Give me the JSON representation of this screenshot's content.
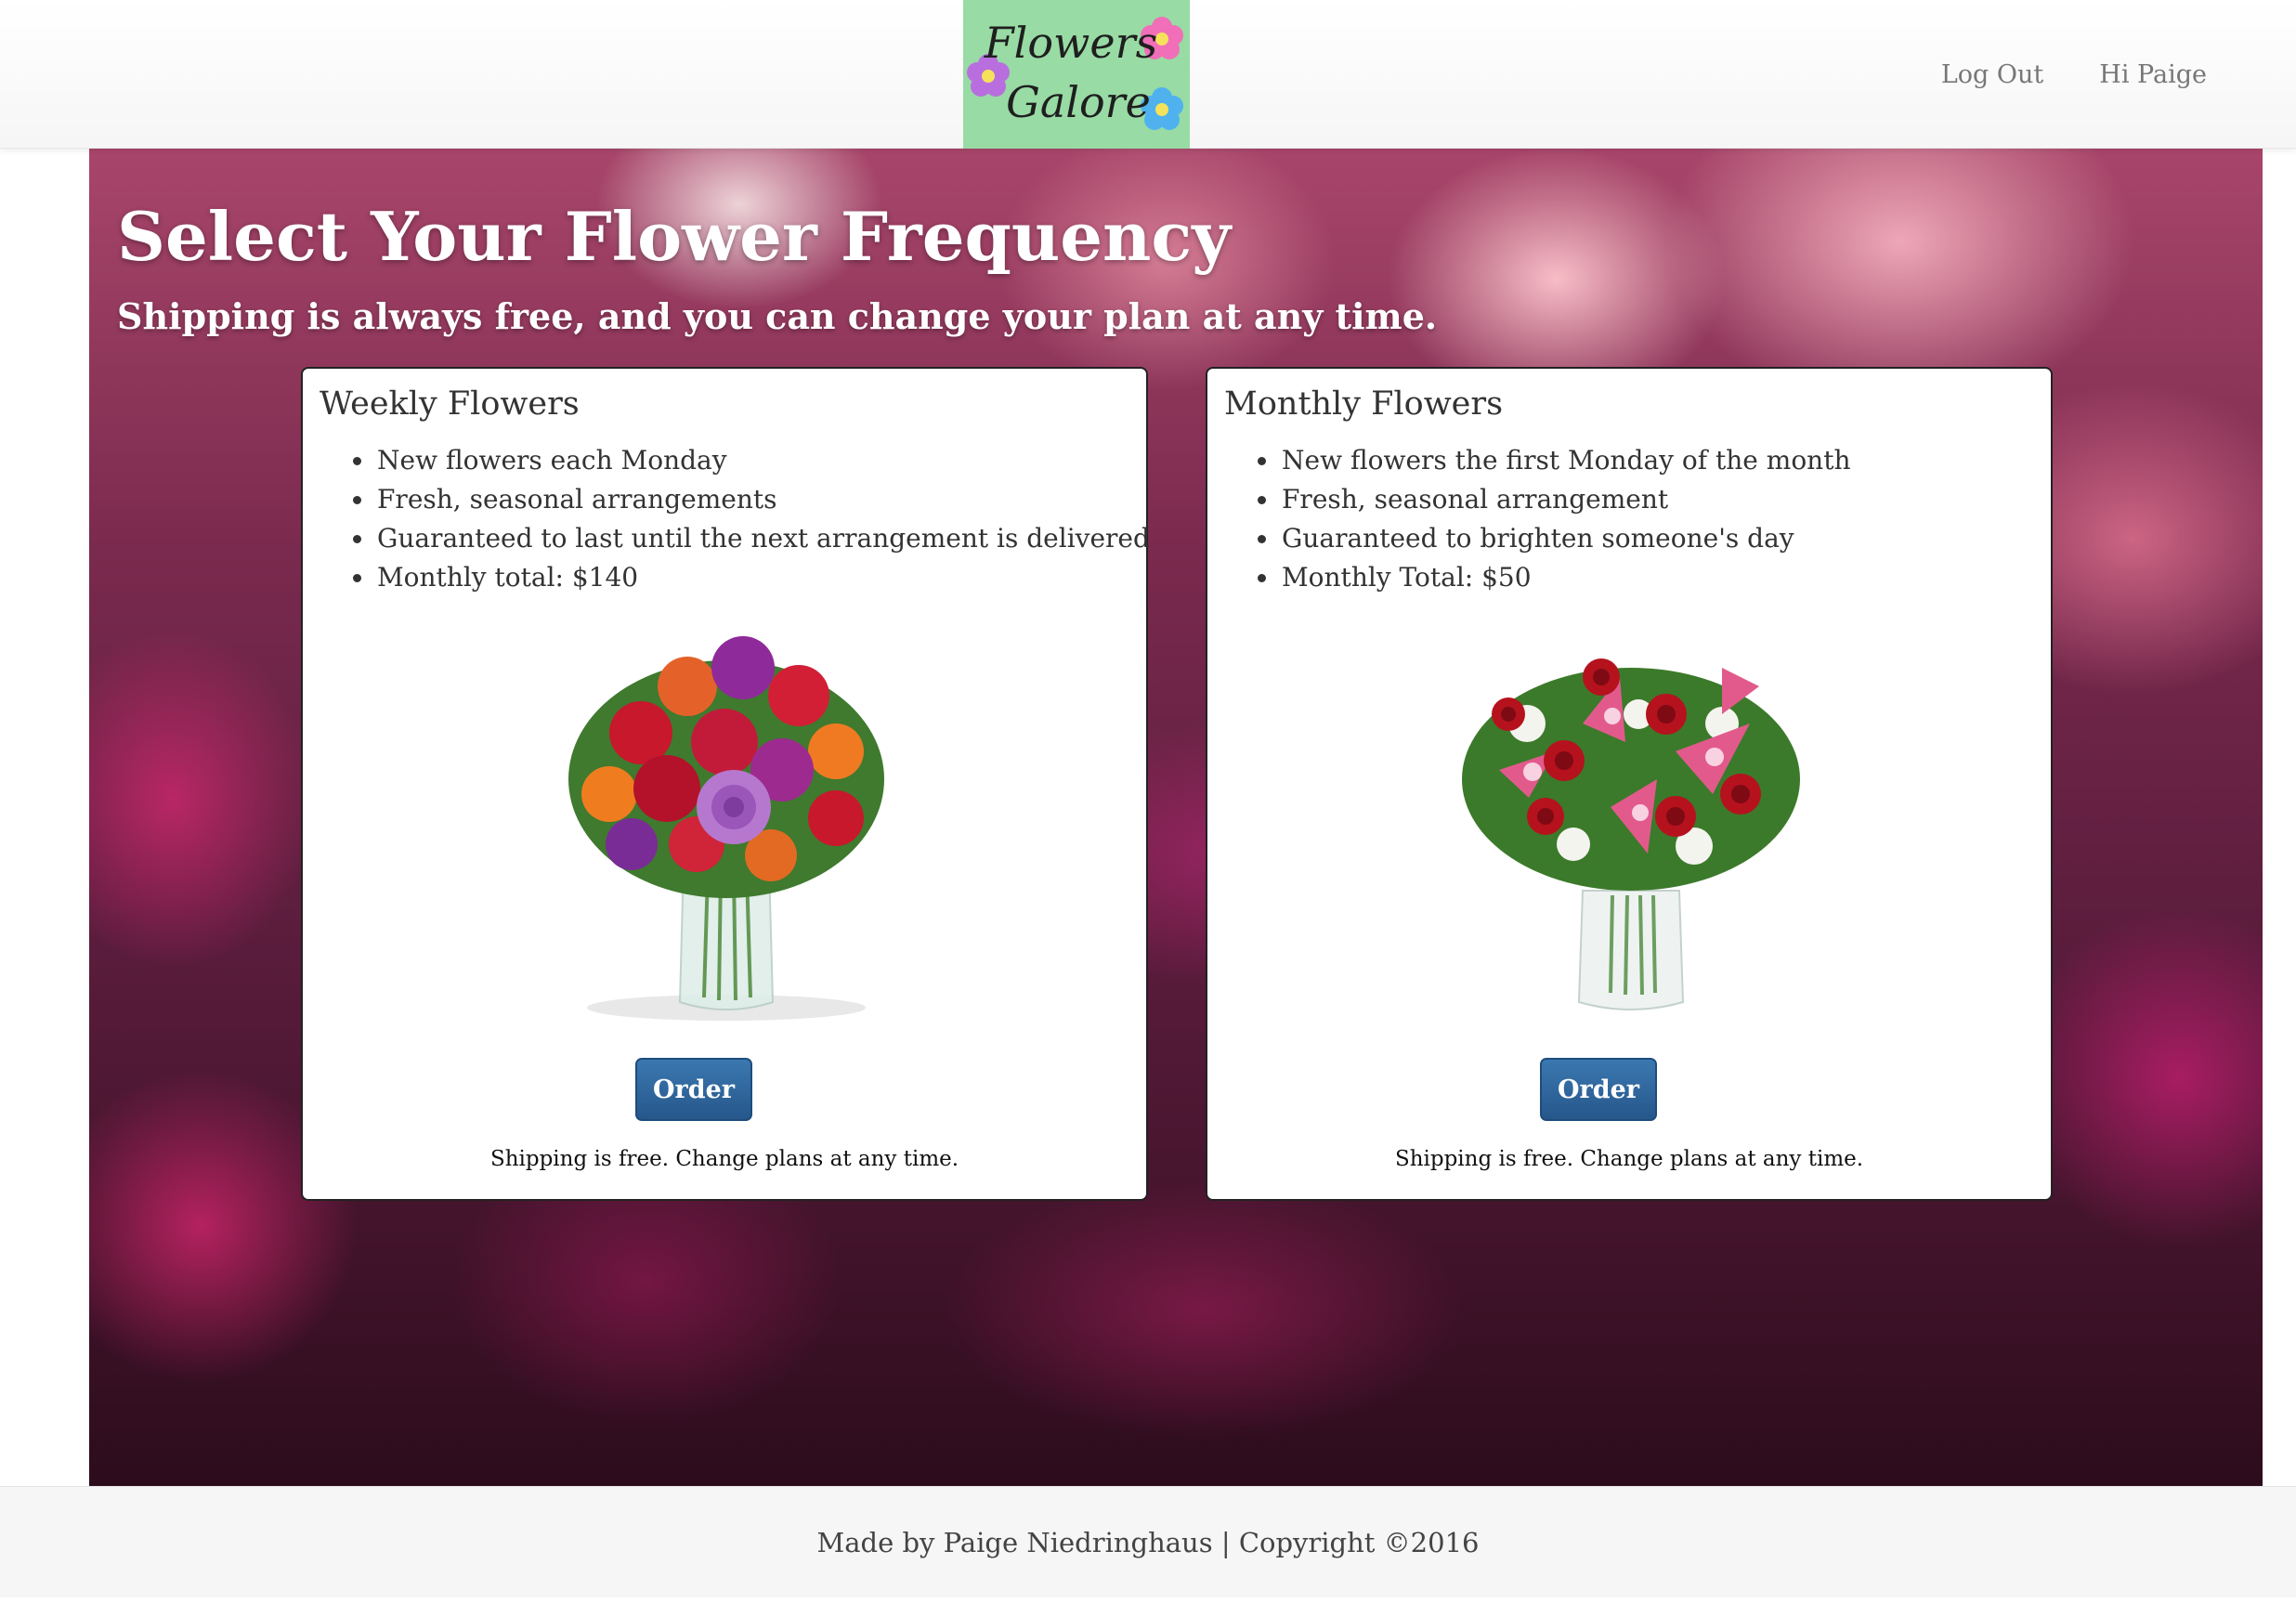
{
  "navbar": {
    "logo_line1": "Flowers",
    "logo_line2": "Galore",
    "links": [
      "Log Out",
      "Hi Paige"
    ]
  },
  "hero": {
    "title": "Select Your Flower Frequency",
    "subtitle": "Shipping is always free, and you can change your plan at any time."
  },
  "plans": [
    {
      "title": "Weekly Flowers",
      "features": [
        "New flowers each Monday",
        "Fresh, seasonal arrangements",
        "Guaranteed to last until the next arrangement is delivered",
        "Monthly total: $140"
      ],
      "image": "mixed-bouquet-in-vase",
      "button_label": "Order",
      "note": "Shipping is free. Change plans at any time."
    },
    {
      "title": "Monthly Flowers",
      "features": [
        "New flowers the first Monday of the month",
        "Fresh, seasonal arrangement",
        "Guaranteed to brighten someone's day",
        "Monthly Total: $50"
      ],
      "image": "roses-and-lilies-in-vase",
      "button_label": "Order",
      "note": "Shipping is free. Change plans at any time."
    }
  ],
  "footer": {
    "text": "Made by Paige Niedringhaus | Copyright ©2016"
  },
  "colors": {
    "logo_bg": "#98dba4",
    "button": "#2f6aa3",
    "nav_text": "#777777"
  }
}
